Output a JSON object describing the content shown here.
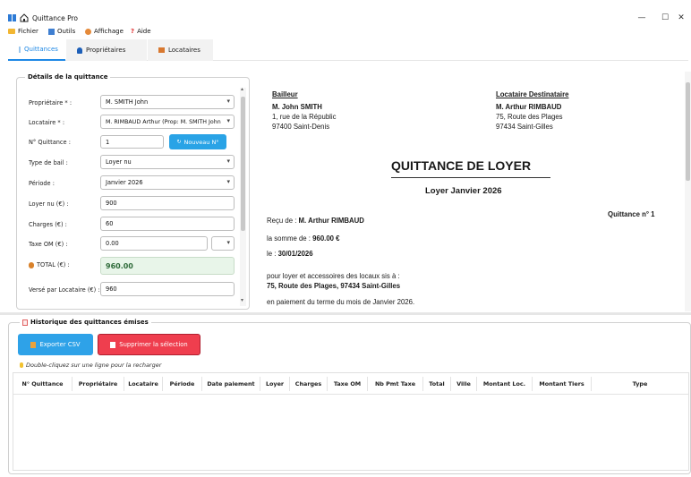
{
  "window": {
    "title": "Quittance Pro",
    "minimize": "—",
    "maximize": "☐",
    "close": "✕"
  },
  "menu": {
    "fichier": "Fichier",
    "outils": "Outils",
    "affichage": "Affichage",
    "aide": "Aide"
  },
  "tabs": [
    {
      "label": "Quittances",
      "active": true
    },
    {
      "label": "Propriétaires",
      "active": false
    },
    {
      "label": "Locataires",
      "active": false
    }
  ],
  "form": {
    "group_title": "Détails de la quittance",
    "proprietaire_label": "Propriétaire * :",
    "proprietaire_value": "M. SMITH John",
    "locataire_label": "Locataire * :",
    "locataire_value": "M. RIMBAUD Arthur (Prop: M. SMITH John",
    "numero_label": "N° Quittance :",
    "numero_value": "1",
    "nouveau_btn": "Nouveau N°",
    "bail_label": "Type de bail :",
    "bail_value": "Loyer nu",
    "periode_label": "Période :",
    "periode_value": "Janvier 2026",
    "loyer_label": "Loyer nu (€) :",
    "loyer_value": "900",
    "charges_label": "Charges (€) :",
    "charges_value": "60",
    "taxe_label": "Taxe OM (€) :",
    "taxe_value": "0.00",
    "total_label": "TOTAL (€) :",
    "total_value": "960.00",
    "verse_label": "Versé par Locataire (€) :",
    "verse_value": "960"
  },
  "document": {
    "bailleur_heading": "Bailleur",
    "bailleur_name": "M. John SMITH",
    "bailleur_addr1": "1, rue de la Républic",
    "bailleur_addr2": "97400 Saint-Denis",
    "locataire_heading": "Locataire Destinataire",
    "locataire_name": "M. Arthur RIMBAUD",
    "locataire_addr1": "75, Route des Plages",
    "locataire_addr2": "97434 Saint-Gilles",
    "title": "QUITTANCE DE LOYER",
    "subtitle": "Loyer Janvier 2026",
    "numero": "Quittance n° 1",
    "recu_prefix": "Reçu de : ",
    "recu_name": "M. Arthur RIMBAUD",
    "somme_prefix": "la somme de : ",
    "somme_value": "960.00 €",
    "le_prefix": "le : ",
    "le_value": "30/01/2026",
    "pour_line": "pour loyer et accessoires des locaux sis à :",
    "adresse_locaux": "75, Route des Plages, 97434 Saint-Gilles",
    "paiement_line": "en paiement du terme du mois de Janvier 2026."
  },
  "history": {
    "group_title": "Historique des quittances émises",
    "export_btn": "Exporter CSV",
    "delete_btn": "Supprimer la sélection",
    "hint": "Double-cliquez sur une ligne pour la recharger",
    "columns": [
      "N° Quittance",
      "Propriétaire",
      "Locataire",
      "Période",
      "Date paiement",
      "Loyer",
      "Charges",
      "Taxe OM",
      "Nb Pmt Taxe",
      "Total",
      "Ville",
      "Montant Loc.",
      "Montant Tiers",
      "Type"
    ]
  },
  "colors": {
    "accent": "#1e88e5",
    "button_blue": "#29a3e6",
    "button_red": "#ef3e4e",
    "total_bg": "#e8f5e9"
  }
}
